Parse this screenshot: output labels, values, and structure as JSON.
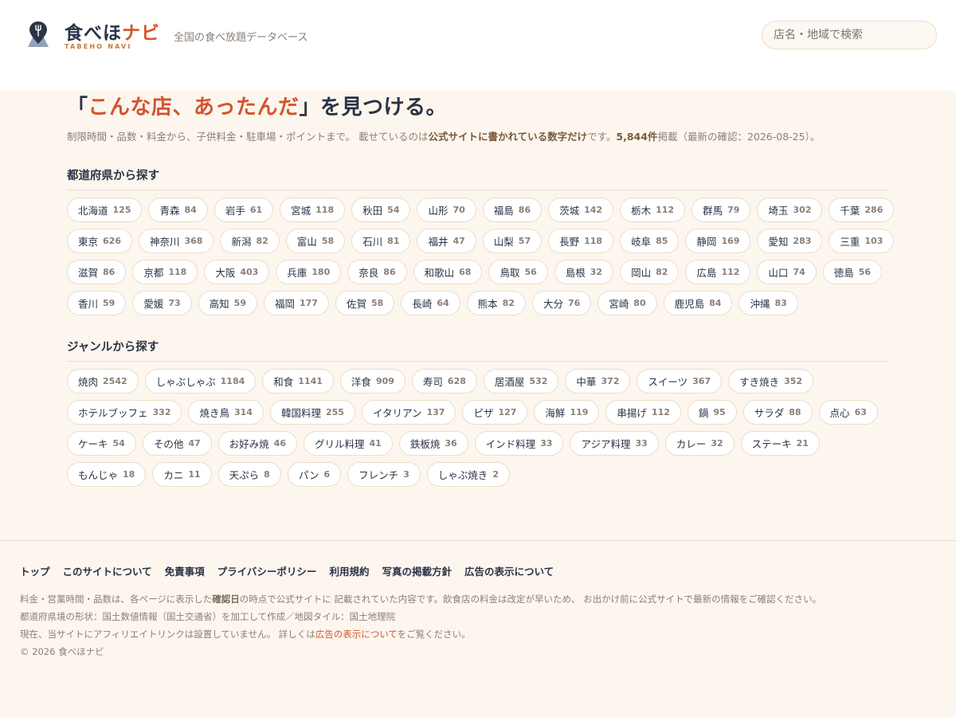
{
  "header": {
    "logo_title_main": "食べほ",
    "logo_title_accent": "ナビ",
    "logo_sub": "TABEHO NAVI",
    "tagline": "全国の食べ放題データベース",
    "search_placeholder": "店名・地域で検索",
    "logo_icon": "map-pin-fork-icon"
  },
  "hero": {
    "title_open": "「",
    "title_accent": "こんな店、あったんだ",
    "title_close": "」を見つける。",
    "desc_1": "制限時間・品数・料金から、子供料金・駐車場・ポイントまで。 載せているのは",
    "desc_bold_1": "公式サイトに書かれている数字だけ",
    "desc_2": "です。",
    "desc_bold_2": "5,844件",
    "desc_3": "掲載（最新の確認：2026-08-25）。"
  },
  "prefectures": {
    "heading": "都道府県から探す",
    "items": [
      {
        "name": "北海道",
        "count": "125"
      },
      {
        "name": "青森",
        "count": "84"
      },
      {
        "name": "岩手",
        "count": "61"
      },
      {
        "name": "宮城",
        "count": "118"
      },
      {
        "name": "秋田",
        "count": "54"
      },
      {
        "name": "山形",
        "count": "70"
      },
      {
        "name": "福島",
        "count": "86"
      },
      {
        "name": "茨城",
        "count": "142"
      },
      {
        "name": "栃木",
        "count": "112"
      },
      {
        "name": "群馬",
        "count": "79"
      },
      {
        "name": "埼玉",
        "count": "302"
      },
      {
        "name": "千葉",
        "count": "286"
      },
      {
        "name": "東京",
        "count": "626"
      },
      {
        "name": "神奈川",
        "count": "368"
      },
      {
        "name": "新潟",
        "count": "82"
      },
      {
        "name": "富山",
        "count": "58"
      },
      {
        "name": "石川",
        "count": "81"
      },
      {
        "name": "福井",
        "count": "47"
      },
      {
        "name": "山梨",
        "count": "57"
      },
      {
        "name": "長野",
        "count": "118"
      },
      {
        "name": "岐阜",
        "count": "85"
      },
      {
        "name": "静岡",
        "count": "169"
      },
      {
        "name": "愛知",
        "count": "283"
      },
      {
        "name": "三重",
        "count": "103"
      },
      {
        "name": "滋賀",
        "count": "86"
      },
      {
        "name": "京都",
        "count": "118"
      },
      {
        "name": "大阪",
        "count": "403"
      },
      {
        "name": "兵庫",
        "count": "180"
      },
      {
        "name": "奈良",
        "count": "86"
      },
      {
        "name": "和歌山",
        "count": "68"
      },
      {
        "name": "鳥取",
        "count": "56"
      },
      {
        "name": "島根",
        "count": "32"
      },
      {
        "name": "岡山",
        "count": "82"
      },
      {
        "name": "広島",
        "count": "112"
      },
      {
        "name": "山口",
        "count": "74"
      },
      {
        "name": "徳島",
        "count": "56"
      },
      {
        "name": "香川",
        "count": "59"
      },
      {
        "name": "愛媛",
        "count": "73"
      },
      {
        "name": "高知",
        "count": "59"
      },
      {
        "name": "福岡",
        "count": "177"
      },
      {
        "name": "佐賀",
        "count": "58"
      },
      {
        "name": "長崎",
        "count": "64"
      },
      {
        "name": "熊本",
        "count": "82"
      },
      {
        "name": "大分",
        "count": "76"
      },
      {
        "name": "宮崎",
        "count": "80"
      },
      {
        "name": "鹿児島",
        "count": "84"
      },
      {
        "name": "沖縄",
        "count": "83"
      }
    ]
  },
  "genres": {
    "heading": "ジャンルから探す",
    "items": [
      {
        "name": "焼肉",
        "count": "2542"
      },
      {
        "name": "しゃぶしゃぶ",
        "count": "1184"
      },
      {
        "name": "和食",
        "count": "1141"
      },
      {
        "name": "洋食",
        "count": "909"
      },
      {
        "name": "寿司",
        "count": "628"
      },
      {
        "name": "居酒屋",
        "count": "532"
      },
      {
        "name": "中華",
        "count": "372"
      },
      {
        "name": "スイーツ",
        "count": "367"
      },
      {
        "name": "すき焼き",
        "count": "352"
      },
      {
        "name": "ホテルブッフェ",
        "count": "332"
      },
      {
        "name": "焼き鳥",
        "count": "314"
      },
      {
        "name": "韓国料理",
        "count": "255"
      },
      {
        "name": "イタリアン",
        "count": "137"
      },
      {
        "name": "ピザ",
        "count": "127"
      },
      {
        "name": "海鮮",
        "count": "119"
      },
      {
        "name": "串揚げ",
        "count": "112"
      },
      {
        "name": "鍋",
        "count": "95"
      },
      {
        "name": "サラダ",
        "count": "88"
      },
      {
        "name": "点心",
        "count": "63"
      },
      {
        "name": "ケーキ",
        "count": "54"
      },
      {
        "name": "その他",
        "count": "47"
      },
      {
        "name": "お好み焼",
        "count": "46"
      },
      {
        "name": "グリル料理",
        "count": "41"
      },
      {
        "name": "鉄板焼",
        "count": "36"
      },
      {
        "name": "インド料理",
        "count": "33"
      },
      {
        "name": "アジア料理",
        "count": "33"
      },
      {
        "name": "カレー",
        "count": "32"
      },
      {
        "name": "ステーキ",
        "count": "21"
      },
      {
        "name": "もんじゃ",
        "count": "18"
      },
      {
        "name": "カニ",
        "count": "11"
      },
      {
        "name": "天ぷら",
        "count": "8"
      },
      {
        "name": "パン",
        "count": "6"
      },
      {
        "name": "フレンチ",
        "count": "3"
      },
      {
        "name": "しゃぶ焼き",
        "count": "2"
      }
    ]
  },
  "footer": {
    "links": [
      "トップ",
      "このサイトについて",
      "免責事項",
      "プライバシーポリシー",
      "利用規約",
      "写真の掲載方針",
      "広告の表示について"
    ],
    "note1_a": "料金・営業時間・品数は、各ページに表示した",
    "note1_bold": "確認日",
    "note1_b": "の時点で公式サイトに 記載されていた内容です。飲食店の料金は改定が早いため、 お出かけ前に公式サイトで最新の情報をご確認ください。",
    "note2": "都道府県境の形状：国土数値情報（国土交通省）を加工して作成／地図タイル：国土地理院",
    "note3_a": "現在、当サイトにアフィリエイトリンクは設置していません。 詳しくは",
    "note3_link": "広告の表示について",
    "note3_b": "をご覧ください。",
    "copyright": "© 2026 食べほナビ"
  },
  "colors": {
    "accent": "#d5542c",
    "navy": "#2b3346",
    "background": "#fdf6ee"
  }
}
